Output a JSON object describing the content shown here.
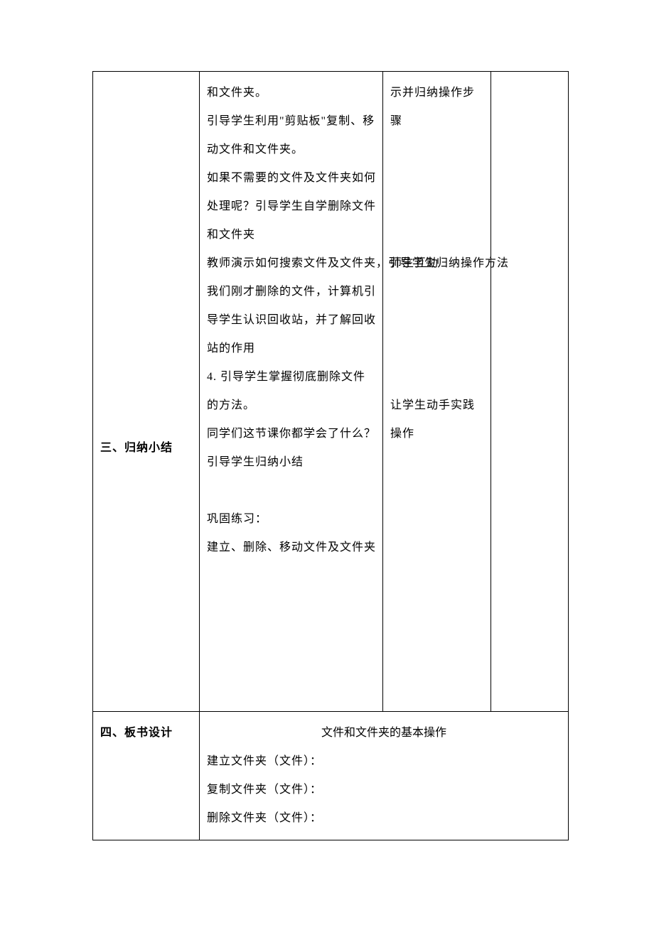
{
  "row1": {
    "col1": "三、归纳小结",
    "col2_lines": [
      "和文件夹。",
      "引导学生利用\"剪贴板\"复制、移动文件和文件夹。",
      "如果不需要的文件及文件夹如何处理呢？引导学生自学删除文件和文件夹",
      "教师演示如何搜索文件及文件夹，引导学生归纳操作方法",
      "我们刚才删除的文件，计算机引导学生认识回收站，并了解回收站的作用",
      "4.  引导学生掌握彻底删除文件的方法。",
      "同学们这节课你都学会了什么？引导学生归纳小结",
      "",
      "巩固练习：",
      "建立、删除、移动文件及文件夹",
      "",
      "",
      "",
      "",
      ""
    ],
    "col3_lines": [
      "示并归纳操作步骤",
      "",
      "",
      "",
      "",
      "师生互动",
      "",
      "",
      "",
      "",
      "让学生动手实践操作"
    ]
  },
  "row2": {
    "col1": "四、板书设计",
    "title": "文件和文件夹的基本操作",
    "lines": [
      "建立文件夹（文件）：",
      "复制文件夹（文件）：",
      "删除文件夹（文件）："
    ]
  }
}
